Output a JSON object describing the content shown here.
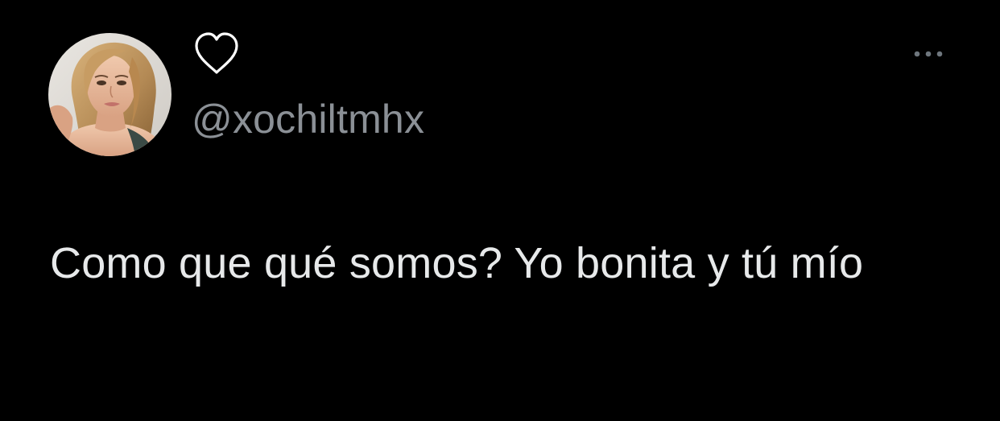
{
  "tweet": {
    "handle": "@xochiltmhx",
    "text": "Como que qué somos? Yo bonita y tú mío"
  },
  "icons": {
    "avatar": "profile-photo",
    "like": "heart-outline-icon",
    "more": "more-options-icon"
  },
  "colors": {
    "background": "#000000",
    "text": "#e7e9ea",
    "handle": "#8b9096",
    "icon": "#ffffff",
    "more": "#6e767d"
  }
}
